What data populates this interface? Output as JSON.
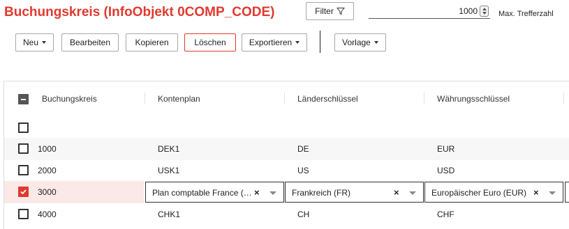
{
  "page": {
    "title": "Buchungskreis (InfoObjekt 0COMP_CODE)"
  },
  "filter": {
    "label": "Filter",
    "icon": "funnel-icon"
  },
  "max_hits": {
    "value": "1000",
    "label": "Max. Trefferzahl"
  },
  "toolbar": {
    "new_label": "Neu",
    "edit_label": "Bearbeiten",
    "copy_label": "Kopieren",
    "delete_label": "Löschen",
    "export_label": "Exportieren",
    "template_label": "Vorlage"
  },
  "table": {
    "columns": [
      "Buchungskreis",
      "Kontenplan",
      "Länderschlüssel",
      "Währungsschlüssel"
    ],
    "rows": [
      {
        "code": "1000",
        "chart": "DEK1",
        "country": "DE",
        "currency": "EUR",
        "checked": false
      },
      {
        "code": "2000",
        "chart": "USK1",
        "country": "US",
        "currency": "USD",
        "checked": false
      },
      {
        "code": "3000",
        "chart": "Plan comptable France (…",
        "country": "Frankreich (FR)",
        "currency": "Europäischer Euro (EUR)",
        "checked": true
      },
      {
        "code": "4000",
        "chart": "CHK1",
        "country": "CH",
        "currency": "CHF",
        "checked": false
      }
    ]
  },
  "colors": {
    "accent": "#e03a2f",
    "selected_row": "#fbe9e7"
  }
}
